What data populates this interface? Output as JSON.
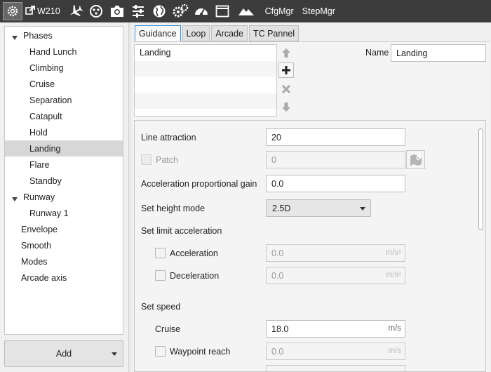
{
  "toolbar": {
    "aircraft_name": "W210",
    "cfgmgr_label": "CfgMgr",
    "stepmgr_label": "StepMgr",
    "icons": [
      "gear-icon",
      "external-link-icon",
      "airplane-icon",
      "paw-icon",
      "camera-icon",
      "sliders-icon",
      "globe-icon",
      "gears-icon",
      "gauge-icon",
      "window-icon",
      "mountains-icon"
    ]
  },
  "tree": {
    "items": [
      {
        "label": "Phases",
        "expanded": true
      },
      {
        "label": "Hand Lunch"
      },
      {
        "label": "Climbing"
      },
      {
        "label": "Cruise"
      },
      {
        "label": "Separation"
      },
      {
        "label": "Catapult"
      },
      {
        "label": "Hold"
      },
      {
        "label": "Landing",
        "selected": true
      },
      {
        "label": "Flare"
      },
      {
        "label": "Standby"
      },
      {
        "label": "Runway",
        "expanded": true
      },
      {
        "label": "Runway 1"
      },
      {
        "label": "Envelope"
      },
      {
        "label": "Smooth"
      },
      {
        "label": "Modes"
      },
      {
        "label": "Arcade axis"
      }
    ],
    "add_label": "Add"
  },
  "tabs": [
    {
      "label": "Guidance",
      "active": true
    },
    {
      "label": "Loop"
    },
    {
      "label": "Arcade"
    },
    {
      "label": "TC Pannel"
    }
  ],
  "list": {
    "rows": [
      "Landing",
      "",
      "",
      ""
    ]
  },
  "name": {
    "label": "Name",
    "value": "Landing"
  },
  "params": {
    "line_attraction": {
      "label": "Line attraction",
      "value": "20"
    },
    "patch": {
      "label": "Patch",
      "value": "0"
    },
    "accel_gain": {
      "label": "Acceleration proportional gain",
      "value": "0.0"
    },
    "height_mode": {
      "label": "Set height mode",
      "value": "2.5D"
    },
    "limit_accel": {
      "label": "Set limit acceleration"
    },
    "acceleration": {
      "label": "Acceleration",
      "value": "0.0",
      "unit": "m/s²"
    },
    "deceleration": {
      "label": "Deceleration",
      "value": "0.0",
      "unit": "m/s²"
    },
    "set_speed": {
      "label": "Set speed"
    },
    "cruise": {
      "label": "Cruise",
      "value": "18.0",
      "unit": "m/s"
    },
    "waypoint_reach": {
      "label": "Waypoint reach",
      "value": "0.0",
      "unit": "m/s"
    }
  }
}
